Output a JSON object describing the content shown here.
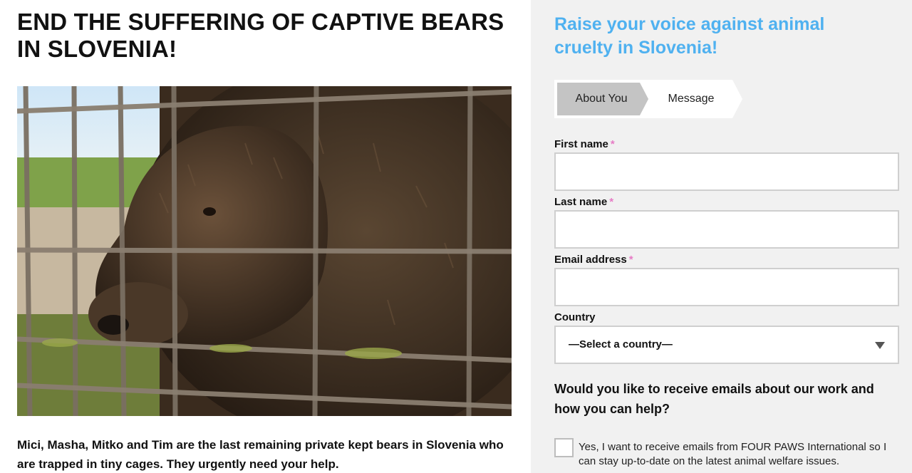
{
  "article": {
    "headline": "END THE SUFFERING OF CAPTIVE BEARS IN SLOVENIA!",
    "intro": "Mici, Masha, Mitko and Tim are the last remaining private kept bears in Slovenia who are trapped in tiny cages. They urgently need your help."
  },
  "form": {
    "title": "Raise your voice against animal cruelty in Slovenia!",
    "steps": [
      {
        "label": "About You",
        "active": true
      },
      {
        "label": "Message",
        "active": false
      }
    ],
    "fields": {
      "first_name": {
        "label": "First name",
        "required_mark": "*",
        "value": ""
      },
      "last_name": {
        "label": "Last name",
        "required_mark": "*",
        "value": ""
      },
      "email": {
        "label": "Email address",
        "required_mark": "*",
        "value": ""
      },
      "country": {
        "label": "Country",
        "selected": "—Select a country—"
      }
    },
    "newsletter": {
      "question": "Would you like to receive emails about our work and how you can help?",
      "consent_label": "Yes, I want to receive emails from FOUR PAWS International so I can stay up-to-date on the latest animal welfare issues.",
      "checked": false
    }
  },
  "colors": {
    "accent": "#4fb1f0",
    "required": "#e67cc5",
    "panel_bg": "#f1f1f1",
    "step_active": "#c4c4c4"
  },
  "icons": {
    "select_caret": "chevron-down-icon"
  }
}
